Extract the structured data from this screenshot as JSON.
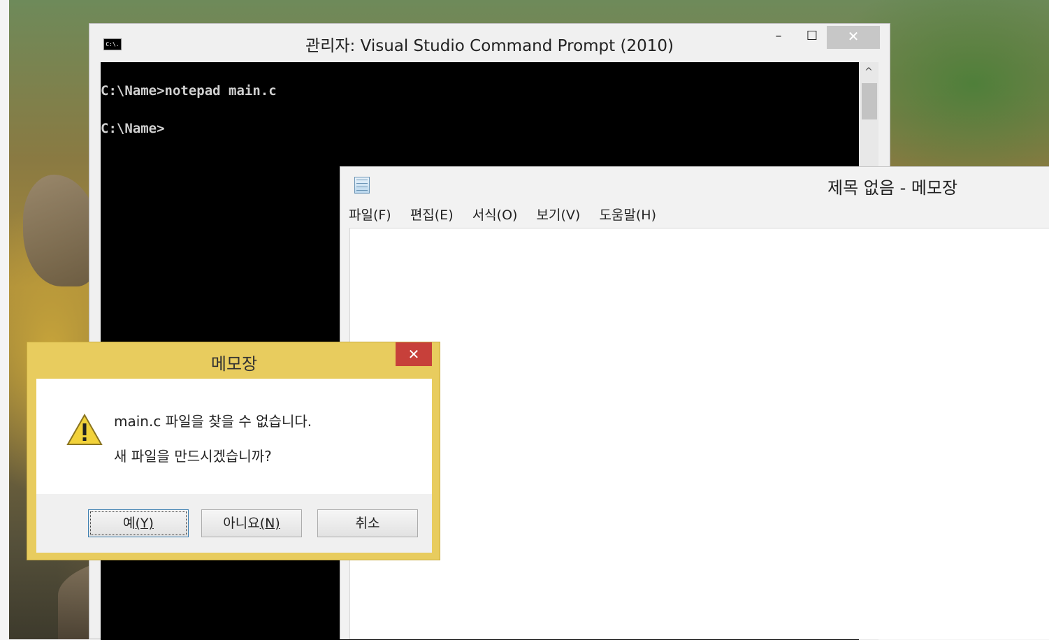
{
  "cmd": {
    "title": "관리자: Visual Studio Command Prompt (2010)",
    "icon_label": "C:\\.",
    "controls": {
      "minimize": "–",
      "maximize": "☐",
      "close": "✕"
    },
    "lines": [
      "C:\\Name>notepad main.c",
      "C:\\Name>"
    ],
    "scroll_up": "^"
  },
  "notepad": {
    "title": "제목 없음 - 메모장",
    "menu": [
      "파일(F)",
      "편집(E)",
      "서식(O)",
      "보기(V)",
      "도움말(H)"
    ]
  },
  "dialog": {
    "title": "메모장",
    "close": "✕",
    "message_line1": "main.c 파일을 찾을 수 없습니다.",
    "message_line2": "새 파일을 만드시겠습니까?",
    "buttons": {
      "yes": {
        "label": "예",
        "accel": "(Y)"
      },
      "no": {
        "label": "아니요",
        "accel": "(N)"
      },
      "cancel": {
        "label": "취소"
      }
    }
  },
  "colors": {
    "dialog_frame": "#e8cc5e",
    "close_red": "#c7403a",
    "console_bg": "#000000"
  },
  "icons": {
    "cmd": "command-prompt-icon",
    "notepad": "notepad-icon",
    "warning": "warning-triangle-icon"
  }
}
